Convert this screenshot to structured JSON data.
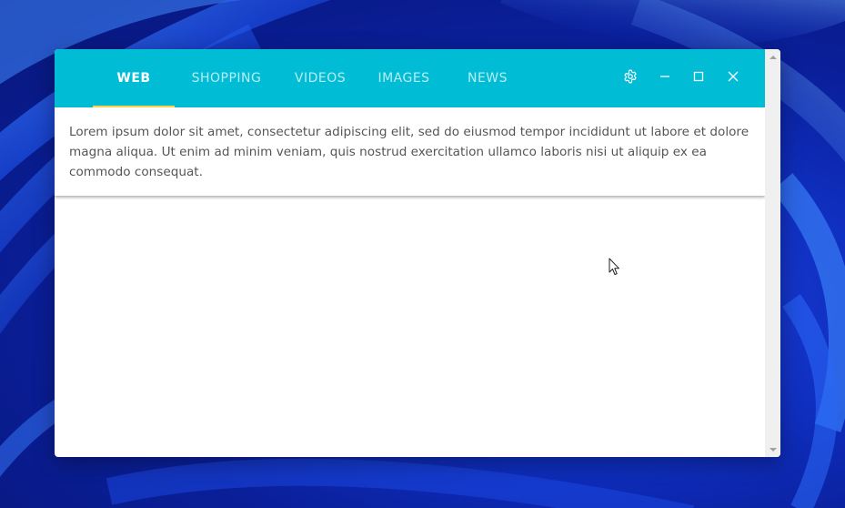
{
  "tabs": [
    {
      "label": "WEB",
      "active": true
    },
    {
      "label": "SHOPPING",
      "active": false
    },
    {
      "label": "VIDEOS",
      "active": false
    },
    {
      "label": "IMAGES",
      "active": false
    },
    {
      "label": "NEWS",
      "active": false
    }
  ],
  "window_controls": {
    "settings_icon": "gear-icon",
    "minimize_icon": "minimize-icon",
    "maximize_icon": "maximize-icon",
    "close_icon": "close-icon"
  },
  "content": {
    "text": "Lorem ipsum dolor sit amet, consectetur adipiscing elit, sed do eiusmod tempor incididunt ut labore et dolore magna aliqua. Ut enim ad minim veniam, quis nostrud exercitation ullamco laboris nisi ut aliquip ex ea commodo consequat."
  },
  "colors": {
    "tab_bar": "#00bcd4",
    "active_indicator": "#ffd54f",
    "desktop_background": "#0f2fc0"
  }
}
